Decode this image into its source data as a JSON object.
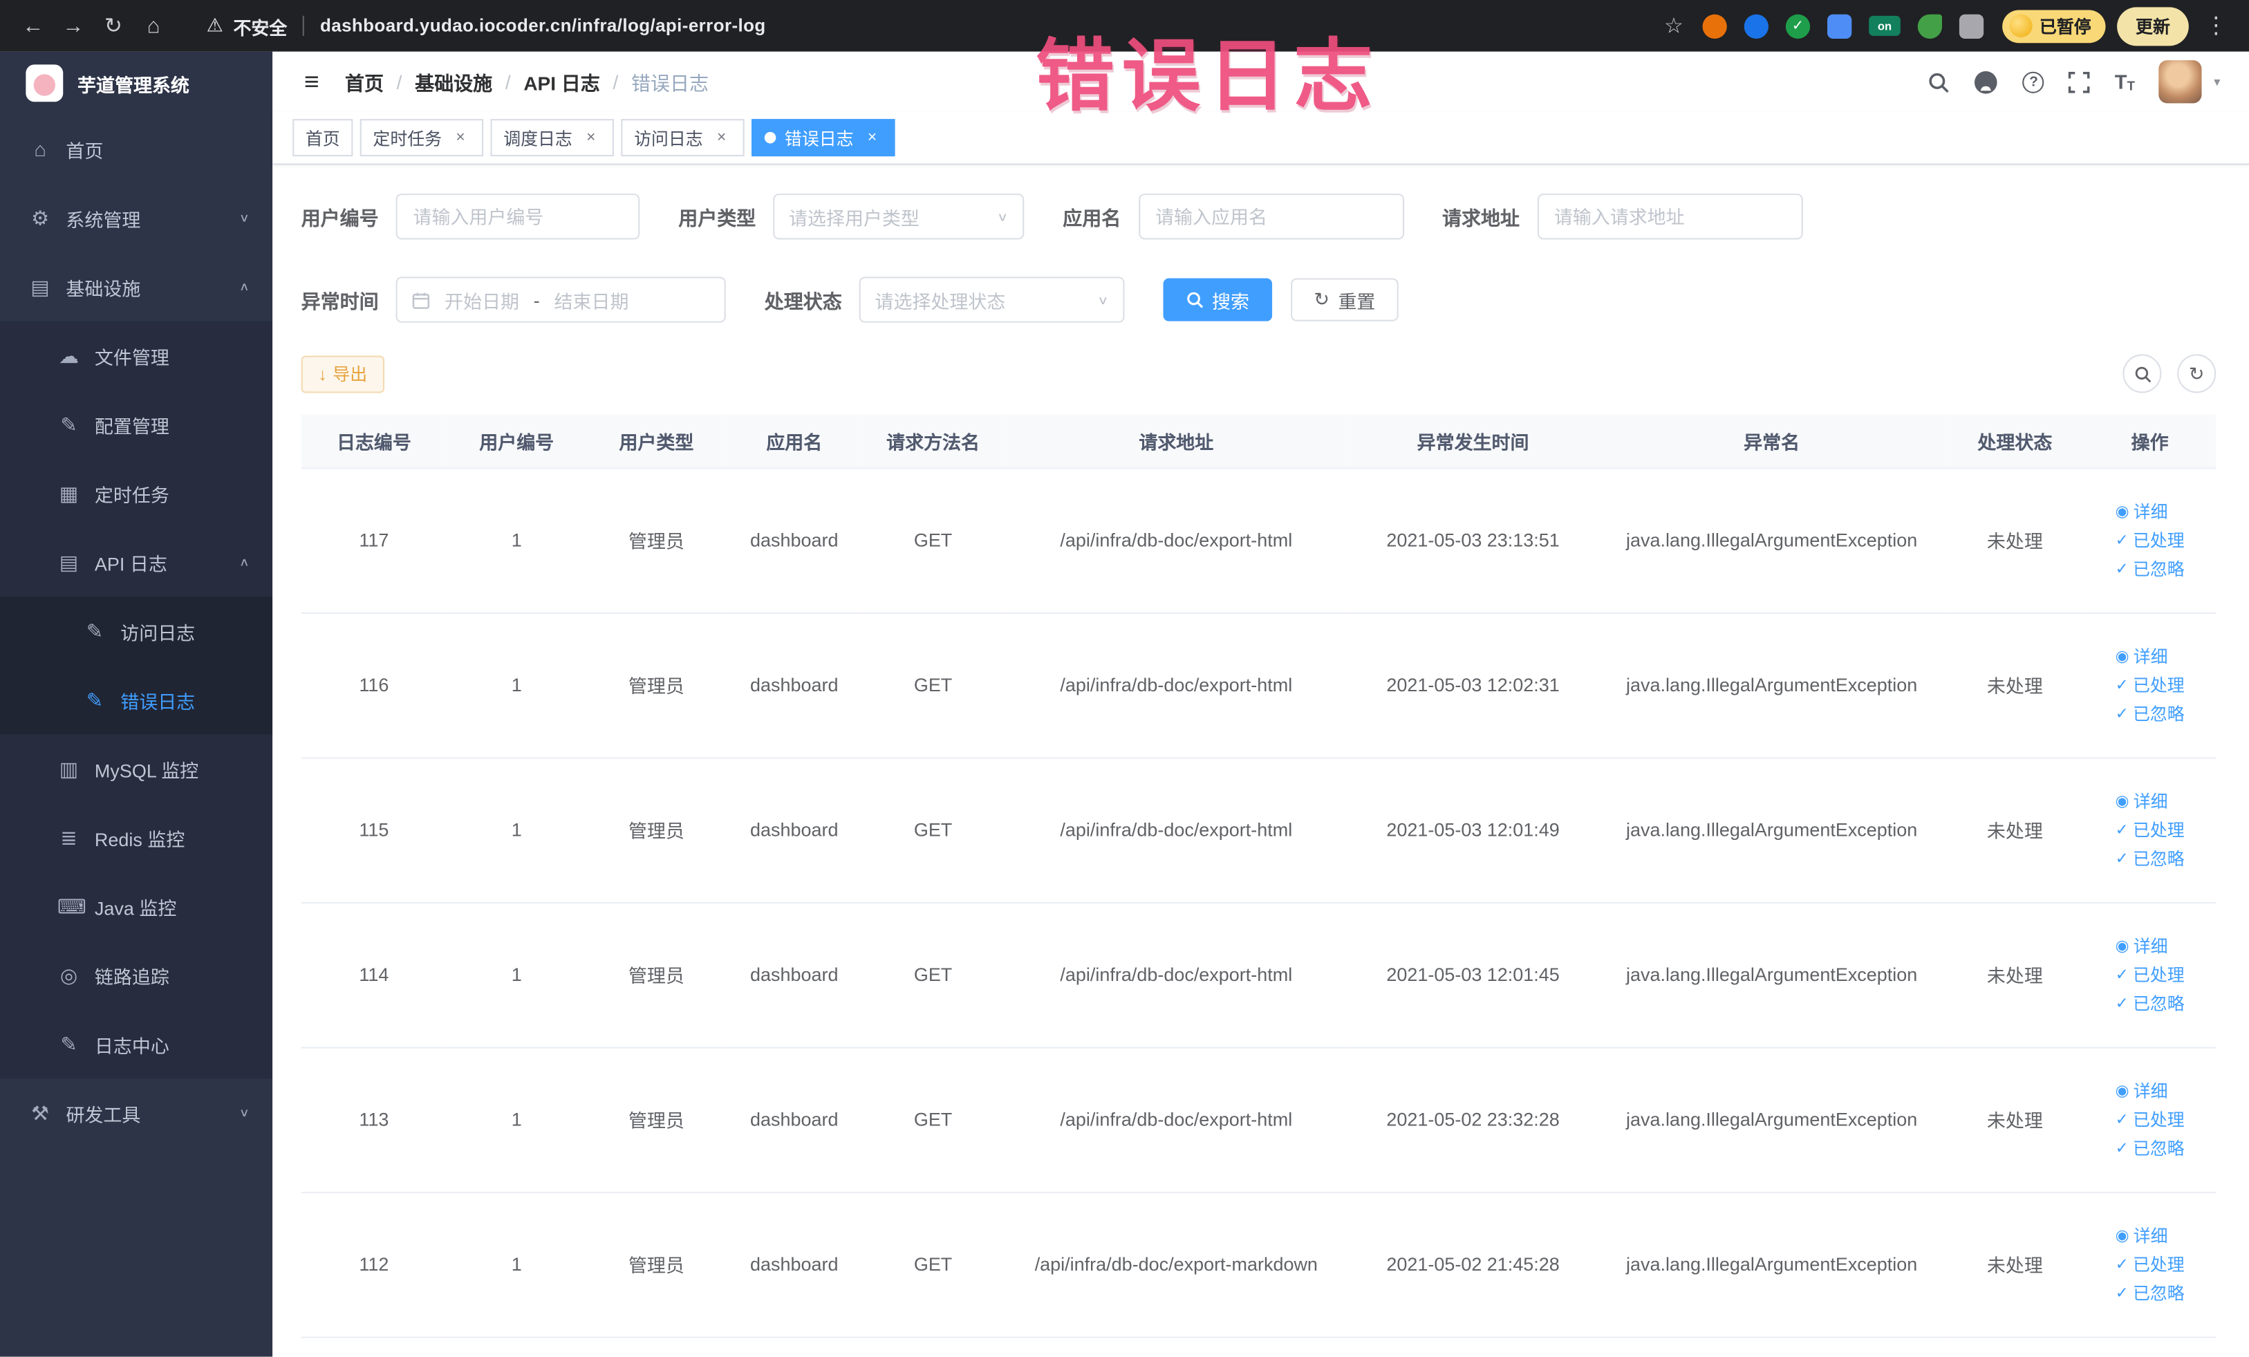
{
  "colors": {
    "accent": "#409eff",
    "warning": "#e6a23c",
    "sidebar_bg": "#2d3448",
    "overlay_pink": "#ee4e7d",
    "active_tab": "#409eff"
  },
  "overlay_label": "错误日志",
  "icons": {
    "menu": "≡",
    "home": "⌂",
    "gear": "⚙",
    "infra": "▤",
    "cloud": "☁",
    "edit": "✎",
    "grid": "▦",
    "doc": "▤",
    "db": "▥",
    "stack": "≣",
    "keyboard": "⌨",
    "eye_circle": "◎",
    "tools": "⚒",
    "chevron_down": "∨",
    "chevron_up": "∧",
    "caret_down": "▾",
    "back": "←",
    "forward": "→",
    "reload": "↻",
    "browser_home": "⌂",
    "warning": "⚠",
    "star": "☆",
    "kebab": "⋮",
    "close": "×",
    "check": "✓",
    "eye": "◉",
    "refresh": "↻",
    "download": "↓",
    "question": "?",
    "font_big": "T",
    "font_small": "T"
  },
  "browser": {
    "security_label": "不安全",
    "url": "dashboard.yudao.iocoder.cn/infra/log/api-error-log",
    "extension_on_label": "on",
    "paused_label": "已暂停",
    "update_label": "更新"
  },
  "sidebar": {
    "logo_title": "芋道管理系统",
    "home": "首页",
    "system": "系统管理",
    "infra": "基础设施",
    "file": "文件管理",
    "config": "配置管理",
    "job": "定时任务",
    "api_log": "API 日志",
    "access_log": "访问日志",
    "error_log": "错误日志",
    "mysql": "MySQL 监控",
    "redis": "Redis 监控",
    "java": "Java 监控",
    "trace": "链路追踪",
    "log_center": "日志中心",
    "dev_tools": "研发工具"
  },
  "header": {
    "breadcrumb": [
      "首页",
      "基础设施",
      "API 日志",
      "错误日志"
    ],
    "separator": "/"
  },
  "tabs": {
    "items": [
      {
        "label": "首页",
        "closable": false,
        "active": false
      },
      {
        "label": "定时任务",
        "closable": true,
        "active": false
      },
      {
        "label": "调度日志",
        "closable": true,
        "active": false
      },
      {
        "label": "访问日志",
        "closable": true,
        "active": false
      },
      {
        "label": "错误日志",
        "closable": true,
        "active": true
      }
    ]
  },
  "filters": {
    "user_id": {
      "label": "用户编号",
      "placeholder": "请输入用户编号"
    },
    "user_type": {
      "label": "用户类型",
      "placeholder": "请选择用户类型"
    },
    "app_name": {
      "label": "应用名",
      "placeholder": "请输入应用名"
    },
    "request_url": {
      "label": "请求地址",
      "placeholder": "请输入请求地址"
    },
    "exception_time": {
      "label": "异常时间",
      "start_placeholder": "开始日期",
      "separator": "-",
      "end_placeholder": "结束日期"
    },
    "process_status": {
      "label": "处理状态",
      "placeholder": "请选择处理状态"
    },
    "search_label": "搜索",
    "reset_label": "重置"
  },
  "toolbar": {
    "export_label": "导出"
  },
  "table": {
    "columns": [
      "日志编号",
      "用户编号",
      "用户类型",
      "应用名",
      "请求方法名",
      "请求地址",
      "异常发生时间",
      "异常名",
      "处理状态",
      "操作"
    ],
    "actions": {
      "detail": "详细",
      "processed": "已处理",
      "ignored": "已忽略"
    },
    "rows": [
      {
        "id": "117",
        "user_id": "1",
        "user_type": "管理员",
        "app": "dashboard",
        "method": "GET",
        "url": "/api/infra/db-doc/export-html",
        "time": "2021-05-03 23:13:51",
        "exception": "java.lang.IllegalArgumentException",
        "status": "未处理"
      },
      {
        "id": "116",
        "user_id": "1",
        "user_type": "管理员",
        "app": "dashboard",
        "method": "GET",
        "url": "/api/infra/db-doc/export-html",
        "time": "2021-05-03 12:02:31",
        "exception": "java.lang.IllegalArgumentException",
        "status": "未处理"
      },
      {
        "id": "115",
        "user_id": "1",
        "user_type": "管理员",
        "app": "dashboard",
        "method": "GET",
        "url": "/api/infra/db-doc/export-html",
        "time": "2021-05-03 12:01:49",
        "exception": "java.lang.IllegalArgumentException",
        "status": "未处理"
      },
      {
        "id": "114",
        "user_id": "1",
        "user_type": "管理员",
        "app": "dashboard",
        "method": "GET",
        "url": "/api/infra/db-doc/export-html",
        "time": "2021-05-03 12:01:45",
        "exception": "java.lang.IllegalArgumentException",
        "status": "未处理"
      },
      {
        "id": "113",
        "user_id": "1",
        "user_type": "管理员",
        "app": "dashboard",
        "method": "GET",
        "url": "/api/infra/db-doc/export-html",
        "time": "2021-05-02 23:32:28",
        "exception": "java.lang.IllegalArgumentException",
        "status": "未处理"
      },
      {
        "id": "112",
        "user_id": "1",
        "user_type": "管理员",
        "app": "dashboard",
        "method": "GET",
        "url": "/api/infra/db-doc/export-markdown",
        "time": "2021-05-02 21:45:28",
        "exception": "java.lang.IllegalArgumentException",
        "status": "未处理"
      }
    ]
  }
}
